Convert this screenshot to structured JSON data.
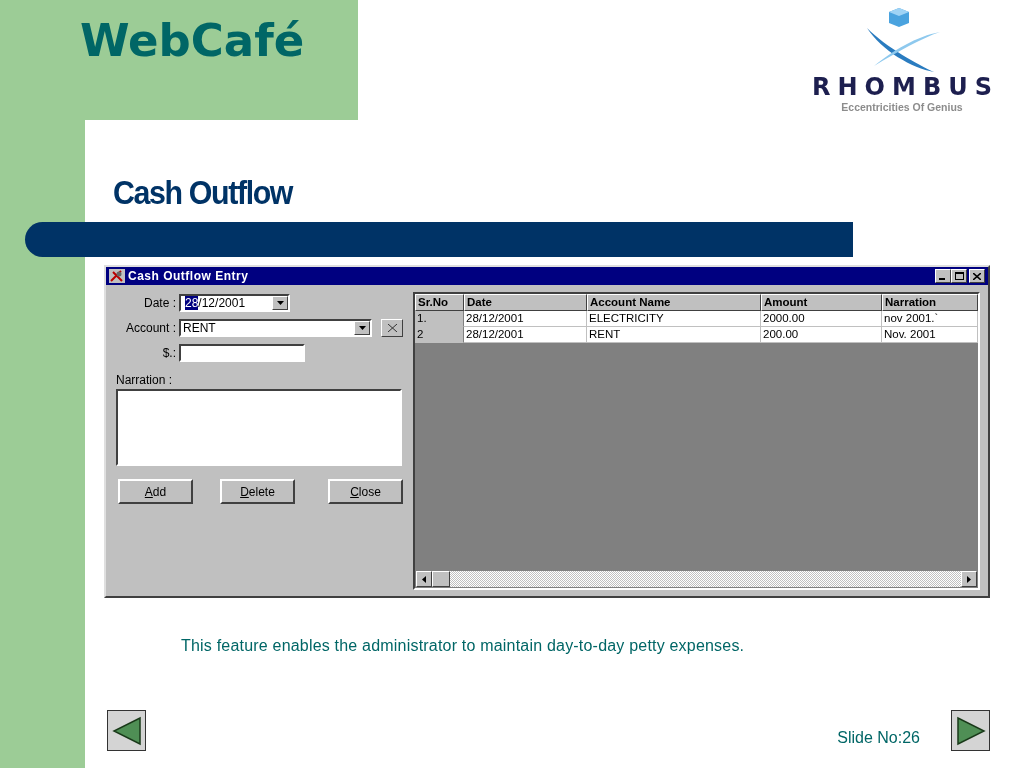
{
  "brand": {
    "title": "WebCafé"
  },
  "logo": {
    "name": "RHOMBUS",
    "tagline": "Eccentricities Of Genius"
  },
  "heading": "Cash Outflow",
  "window": {
    "title": "Cash Outflow Entry"
  },
  "form": {
    "date": {
      "label": "Date :",
      "value_parts": [
        {
          "text": "28",
          "selected": true
        },
        {
          "text": "/12/2001",
          "selected": false
        }
      ]
    },
    "account": {
      "label": "Account :",
      "value": "RENT"
    },
    "amount": {
      "label": "$.:"
    },
    "narration": {
      "label": "Narration :"
    },
    "buttons": [
      {
        "key": "A",
        "rest": "dd"
      },
      {
        "key": "D",
        "rest": "elete"
      },
      {
        "key": "C",
        "rest": "lose"
      }
    ]
  },
  "table": {
    "columns": [
      "Sr.No",
      "Date",
      "Account Name",
      "Amount",
      "Narration"
    ],
    "rows": [
      [
        "1.",
        "28/12/2001",
        "ELECTRICITY",
        "2000.00",
        "nov 2001.`"
      ],
      [
        "2",
        "28/12/2001",
        "RENT",
        "200.00",
        "Nov. 2001"
      ]
    ]
  },
  "caption": "This feature enables the administrator to maintain day-to-day petty expenses.",
  "footer": {
    "slide_number": "Slide No:26"
  }
}
